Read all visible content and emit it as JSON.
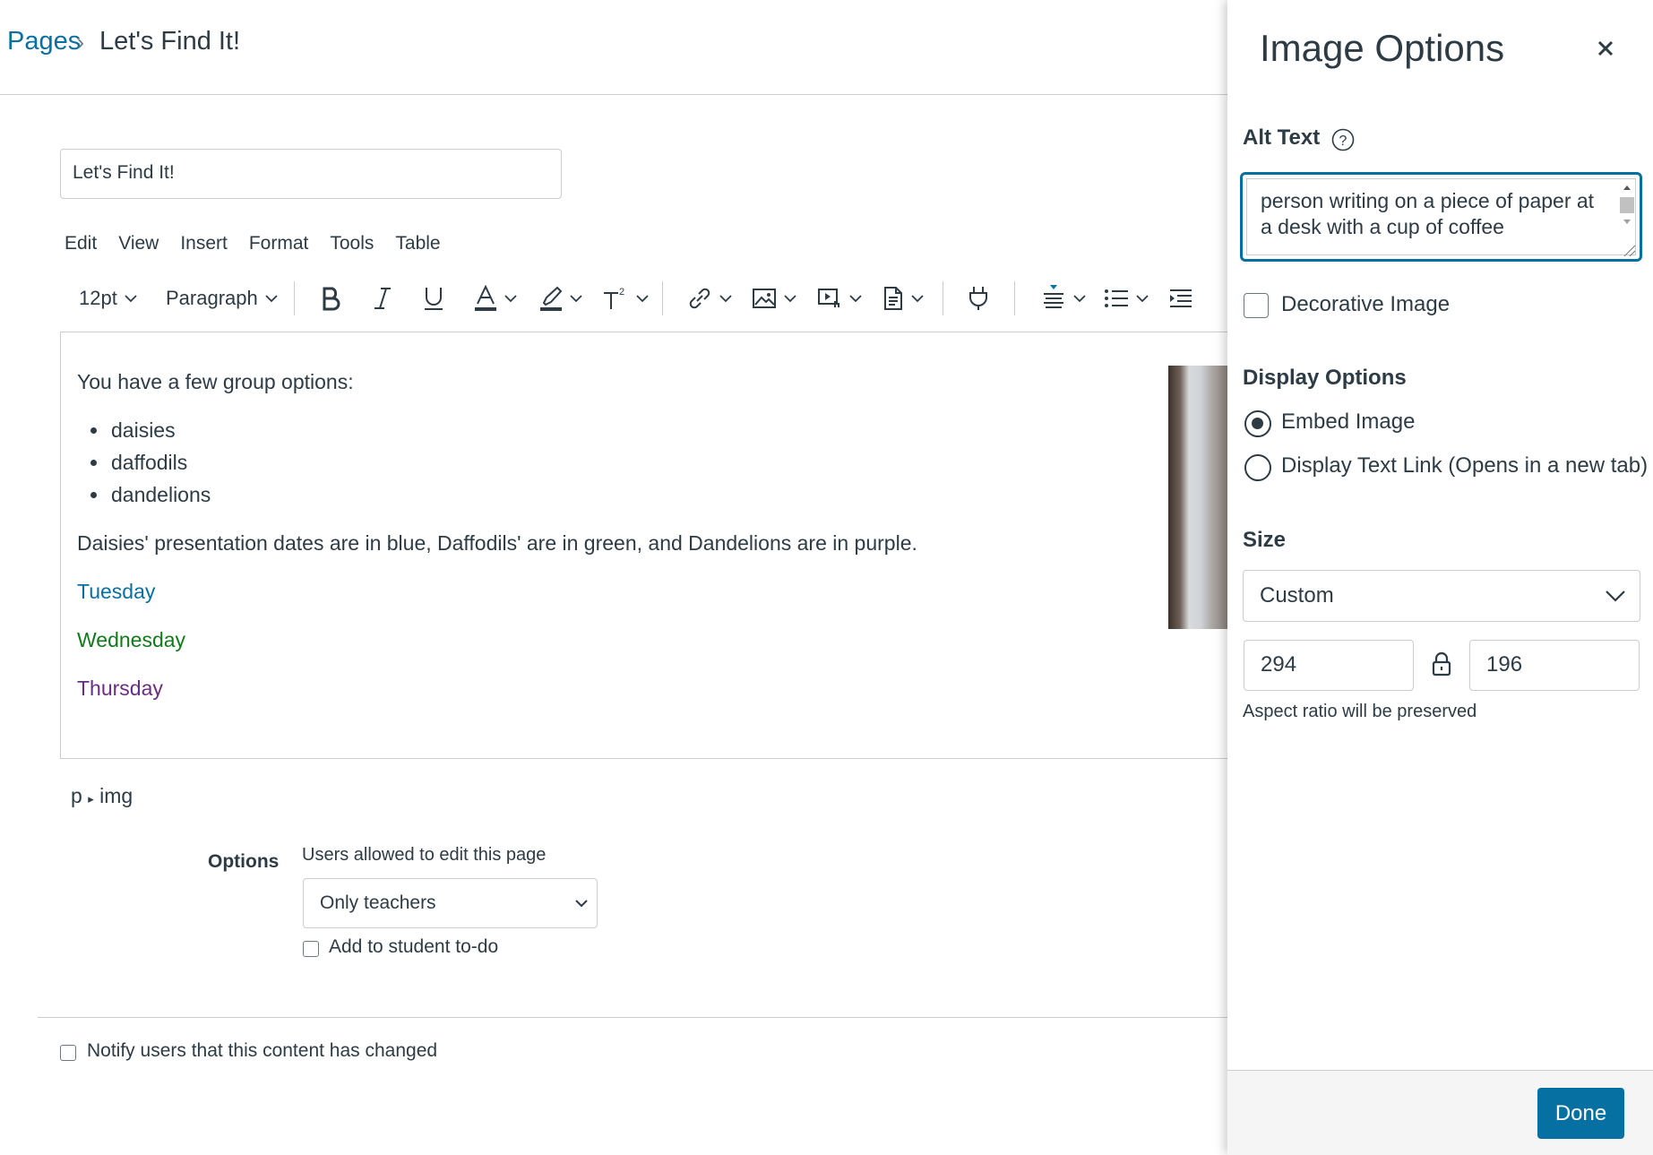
{
  "breadcrumb": {
    "root": "Pages",
    "separator": "›",
    "current": "Let's Find It!"
  },
  "page_title_value": "Let's Find It!",
  "menubar": [
    "Edit",
    "View",
    "Insert",
    "Format",
    "Tools",
    "Table"
  ],
  "toolbar": {
    "font_size": "12pt",
    "block_format": "Paragraph"
  },
  "editor": {
    "intro": "You have a few group options:",
    "groups": [
      "daisies",
      "daffodils",
      "dandelions"
    ],
    "note": "Daisies' presentation dates are in blue, Daffodils' are in green, and Dandelions are in purple.",
    "days": [
      {
        "label": "Tuesday",
        "color": "#0770a3"
      },
      {
        "label": "Wednesday",
        "color": "#127a1b"
      },
      {
        "label": "Thursday",
        "color": "#6b2d83"
      }
    ]
  },
  "element_path": {
    "p": "p",
    "img": "img"
  },
  "options": {
    "label": "Options",
    "edit_desc": "Users allowed to edit this page",
    "edit_value": "Only teachers",
    "todo_label": "Add to student to-do",
    "notify_label": "Notify users that this content has changed"
  },
  "tray": {
    "title": "Image Options",
    "alt_label": "Alt Text",
    "alt_value": "person writing on a piece of paper at a desk with a cup of coffee",
    "decorative_label": "Decorative Image",
    "display_label": "Display Options",
    "embed_label": "Embed Image",
    "link_label": "Display Text Link (Opens in a new tab)",
    "size_label": "Size",
    "size_value": "Custom",
    "width": "294",
    "height": "196",
    "aspect_note": "Aspect ratio will be preserved",
    "done_label": "Done"
  },
  "colors": {
    "accent": "#0770a3",
    "text": "#2d3b45",
    "border": "#c7cdd1"
  }
}
